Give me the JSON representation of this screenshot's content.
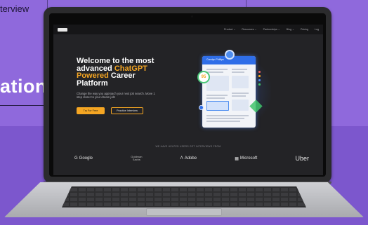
{
  "background": {
    "top_text": "terview",
    "big_text": "ation"
  },
  "site": {
    "logo": "logo",
    "nav": [
      "Product ⌄",
      "Resources ⌄",
      "Partnerships ⌄",
      "Blog ⌄",
      "Pricing",
      "Log"
    ],
    "hero": {
      "title_line1": "Welcome to the most",
      "title_line2a": "advanced ",
      "title_line2b": "ChatGPT",
      "title_line3a": "Powered",
      "title_line3b": " Career",
      "title_line4": "Platform",
      "subtitle": "Change the way you approach your next job search. Move 1 step closer to your dream job!",
      "primary_button": "Try For Free",
      "secondary_button": "Practice Interview"
    },
    "resume": {
      "name": "Carolyn Phillips",
      "score": "95"
    },
    "brands_label": "WE HAVE HELPED USERS GET INTERVIEWS FROM",
    "brands": {
      "google": "Google",
      "goldman": "Goldman\nSachs",
      "adobe": "Adobe",
      "microsoft": "Microsoft",
      "uber": "Uber"
    }
  },
  "colors": {
    "accent": "#f5a623",
    "background": "#8f69dc",
    "screen_bg": "#232326"
  }
}
